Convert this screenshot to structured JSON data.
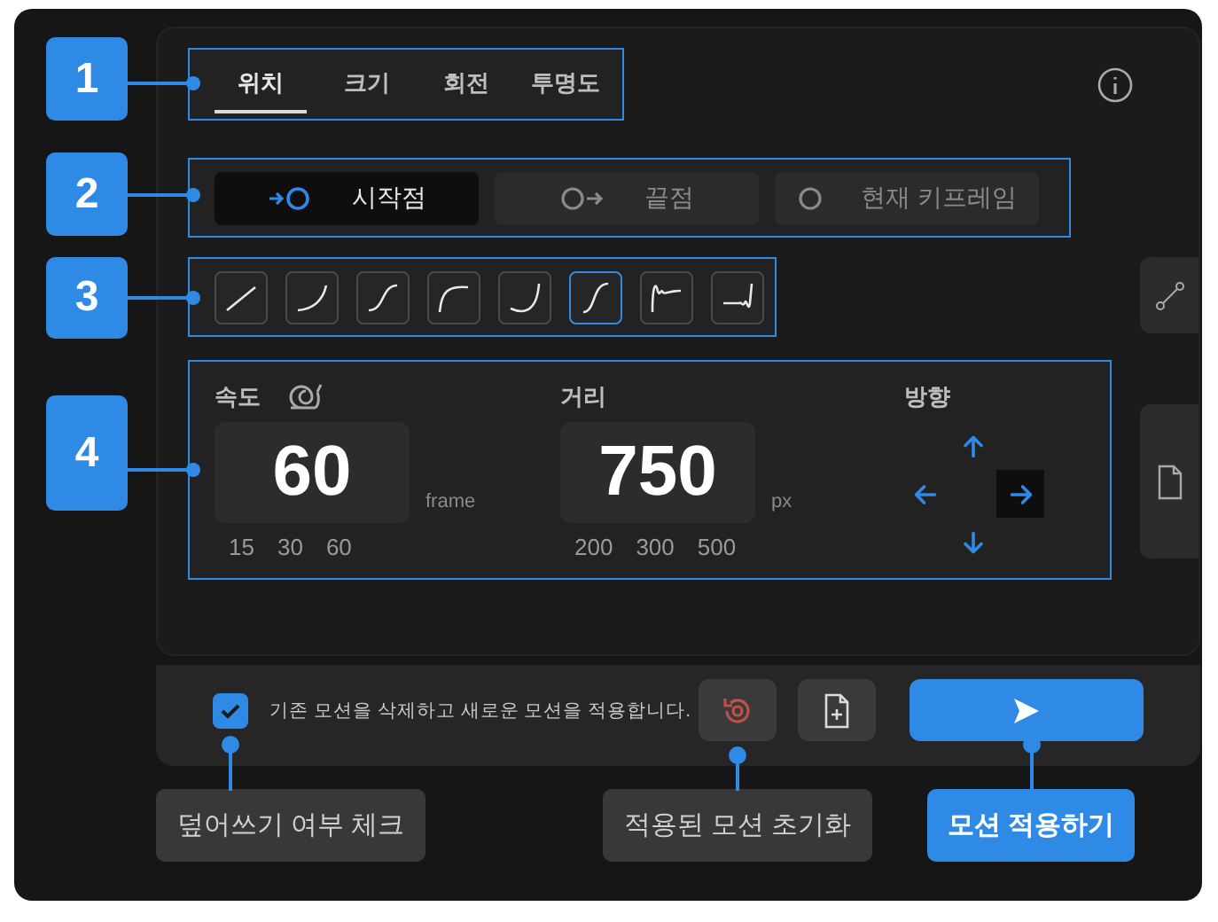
{
  "steps": [
    {
      "number": "1"
    },
    {
      "number": "2"
    },
    {
      "number": "3"
    },
    {
      "number": "4"
    }
  ],
  "tabs": [
    {
      "label": "위치",
      "selected": true
    },
    {
      "label": "크기",
      "selected": false
    },
    {
      "label": "회전",
      "selected": false
    },
    {
      "label": "투명도",
      "selected": false
    }
  ],
  "anchor_options": [
    {
      "label": "시작점",
      "kind": "start",
      "selected": true
    },
    {
      "label": "끝점",
      "kind": "end",
      "selected": false
    },
    {
      "label": "현재 키프레임",
      "kind": "current",
      "selected": false
    }
  ],
  "easing_presets": [
    {
      "kind": "linear",
      "selected": false
    },
    {
      "kind": "ease-in",
      "selected": false
    },
    {
      "kind": "ease-in-out",
      "selected": false
    },
    {
      "kind": "ease-out",
      "selected": false
    },
    {
      "kind": "ease-in-strong",
      "selected": false
    },
    {
      "kind": "ease-in-out-strong",
      "selected": true
    },
    {
      "kind": "elastic-out",
      "selected": false
    },
    {
      "kind": "elastic-in",
      "selected": false
    }
  ],
  "speed": {
    "label": "속도",
    "value": "60",
    "unit": "frame",
    "presets": [
      "15",
      "30",
      "60"
    ]
  },
  "distance": {
    "label": "거리",
    "value": "750",
    "unit": "px",
    "presets": [
      "200",
      "300",
      "500"
    ]
  },
  "direction": {
    "label": "방향",
    "options": [
      {
        "kind": "up",
        "selected": false
      },
      {
        "kind": "left",
        "selected": false
      },
      {
        "kind": "right",
        "selected": true
      },
      {
        "kind": "down",
        "selected": false
      }
    ]
  },
  "overwrite": {
    "checked": true,
    "label": "기존 모션을 삭제하고 새로운 모션을 적용합니다."
  },
  "callouts": [
    {
      "label": "덮어쓰기 여부 체크",
      "kind": "plain"
    },
    {
      "label": "적용된 모션 초기화",
      "kind": "plain"
    },
    {
      "label": "모션 적용하기",
      "kind": "primary"
    }
  ]
}
